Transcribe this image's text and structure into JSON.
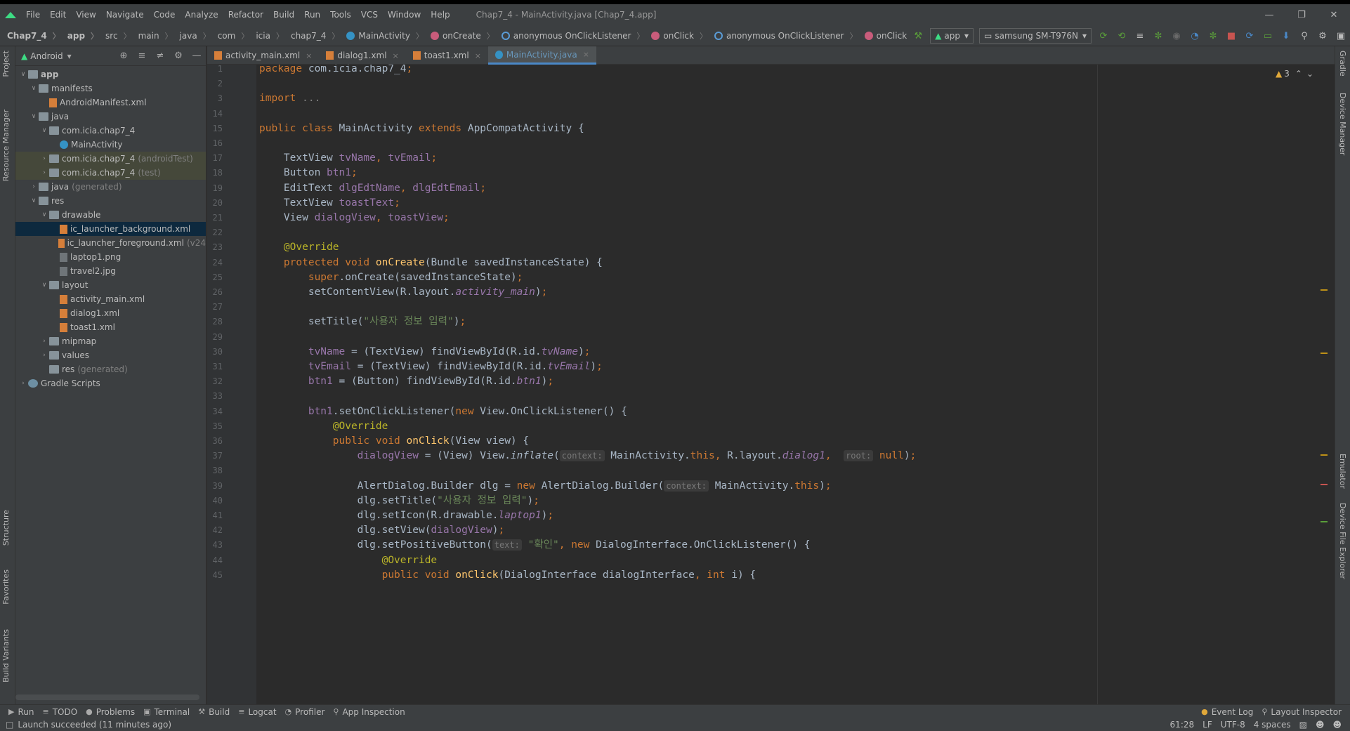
{
  "menubar": {
    "items": [
      "File",
      "Edit",
      "View",
      "Navigate",
      "Code",
      "Analyze",
      "Refactor",
      "Build",
      "Run",
      "Tools",
      "VCS",
      "Window",
      "Help"
    ],
    "title": "Chap7_4 - MainActivity.java [Chap7_4.app]"
  },
  "breadcrumbs": [
    "Chap7_4",
    "app",
    "src",
    "main",
    "java",
    "com",
    "icia",
    "chap7_4",
    "MainActivity",
    "onCreate",
    "anonymous OnClickListener",
    "onClick",
    "anonymous OnClickListener",
    "onClick"
  ],
  "toolbar": {
    "config": "app",
    "device": "samsung SM-T976N"
  },
  "project": {
    "view": "Android",
    "tree": [
      {
        "depth": 0,
        "arrow": "v",
        "icon": "folder",
        "label": "app",
        "bold": true
      },
      {
        "depth": 1,
        "arrow": "v",
        "icon": "folder",
        "label": "manifests"
      },
      {
        "depth": 2,
        "arrow": "",
        "icon": "xml",
        "label": "AndroidManifest.xml"
      },
      {
        "depth": 1,
        "arrow": "v",
        "icon": "folder",
        "label": "java"
      },
      {
        "depth": 2,
        "arrow": "v",
        "icon": "folder",
        "label": "com.icia.chap7_4"
      },
      {
        "depth": 3,
        "arrow": "",
        "icon": "cls",
        "label": "MainActivity"
      },
      {
        "depth": 2,
        "arrow": ">",
        "icon": "folder",
        "label": "com.icia.chap7_4",
        "suffix": "(androidTest)",
        "mod": true
      },
      {
        "depth": 2,
        "arrow": ">",
        "icon": "folder",
        "label": "com.icia.chap7_4",
        "suffix": "(test)",
        "mod": true
      },
      {
        "depth": 1,
        "arrow": ">",
        "icon": "folder",
        "label": "java",
        "suffix": "(generated)"
      },
      {
        "depth": 1,
        "arrow": "v",
        "icon": "folder",
        "label": "res"
      },
      {
        "depth": 2,
        "arrow": "v",
        "icon": "folder",
        "label": "drawable"
      },
      {
        "depth": 3,
        "arrow": "",
        "icon": "xml",
        "label": "ic_launcher_background.xml",
        "sel": true
      },
      {
        "depth": 3,
        "arrow": "",
        "icon": "xml",
        "label": "ic_launcher_foreground.xml",
        "suffix": "(v24"
      },
      {
        "depth": 3,
        "arrow": "",
        "icon": "img",
        "label": "laptop1.png"
      },
      {
        "depth": 3,
        "arrow": "",
        "icon": "img",
        "label": "travel2.jpg"
      },
      {
        "depth": 2,
        "arrow": "v",
        "icon": "folder",
        "label": "layout"
      },
      {
        "depth": 3,
        "arrow": "",
        "icon": "xml",
        "label": "activity_main.xml"
      },
      {
        "depth": 3,
        "arrow": "",
        "icon": "xml",
        "label": "dialog1.xml"
      },
      {
        "depth": 3,
        "arrow": "",
        "icon": "xml",
        "label": "toast1.xml"
      },
      {
        "depth": 2,
        "arrow": ">",
        "icon": "folder",
        "label": "mipmap"
      },
      {
        "depth": 2,
        "arrow": ">",
        "icon": "folder",
        "label": "values"
      },
      {
        "depth": 2,
        "arrow": "",
        "icon": "folder",
        "label": "res",
        "suffix": "(generated)"
      },
      {
        "depth": 0,
        "arrow": ">",
        "icon": "gradle",
        "label": "Gradle Scripts"
      }
    ]
  },
  "tabs": [
    {
      "label": "activity_main.xml",
      "active": false
    },
    {
      "label": "dialog1.xml",
      "active": false
    },
    {
      "label": "toast1.xml",
      "active": false
    },
    {
      "label": "MainActivity.java",
      "active": true
    }
  ],
  "editor": {
    "warnings": "3",
    "lines": [
      {
        "n": "1",
        "parts": [
          [
            "kw",
            "package "
          ],
          [
            "",
            "com.icia.chap7_4"
          ],
          [
            "kw",
            ";"
          ]
        ]
      },
      {
        "n": "2",
        "parts": []
      },
      {
        "n": "3",
        "parts": [
          [
            "kw",
            "import "
          ],
          [
            "gray",
            "..."
          ]
        ]
      },
      {
        "n": "14",
        "parts": []
      },
      {
        "n": "15",
        "parts": [
          [
            "kw",
            "public class "
          ],
          [
            "",
            "MainActivity "
          ],
          [
            "kw",
            "extends "
          ],
          [
            "",
            "AppCompatActivity {"
          ]
        ]
      },
      {
        "n": "16",
        "parts": []
      },
      {
        "n": "17",
        "parts": [
          [
            "",
            "    TextView "
          ],
          [
            "fld",
            "tvName"
          ],
          [
            "kw",
            ", "
          ],
          [
            "fld",
            "tvEmail"
          ],
          [
            "kw",
            ";"
          ]
        ]
      },
      {
        "n": "18",
        "parts": [
          [
            "",
            "    Button "
          ],
          [
            "fld",
            "btn1"
          ],
          [
            "kw",
            ";"
          ]
        ]
      },
      {
        "n": "19",
        "parts": [
          [
            "",
            "    EditText "
          ],
          [
            "fld",
            "dlgEdtName"
          ],
          [
            "kw",
            ", "
          ],
          [
            "fld",
            "dlgEdtEmail"
          ],
          [
            "kw",
            ";"
          ]
        ]
      },
      {
        "n": "20",
        "parts": [
          [
            "",
            "    TextView "
          ],
          [
            "fld",
            "toastText"
          ],
          [
            "kw",
            ";"
          ]
        ]
      },
      {
        "n": "21",
        "parts": [
          [
            "",
            "    View "
          ],
          [
            "fld",
            "dialogView"
          ],
          [
            "kw",
            ", "
          ],
          [
            "fld",
            "toastView"
          ],
          [
            "kw",
            ";"
          ]
        ]
      },
      {
        "n": "22",
        "parts": []
      },
      {
        "n": "23",
        "parts": [
          [
            "ann",
            "    @Override"
          ]
        ]
      },
      {
        "n": "24",
        "parts": [
          [
            "kw",
            "    protected void "
          ],
          [
            "mth",
            "onCreate"
          ],
          [
            "",
            "(Bundle savedInstanceState) {"
          ]
        ]
      },
      {
        "n": "25",
        "parts": [
          [
            "kw",
            "        super"
          ],
          [
            "",
            ".onCreate(savedInstanceState)"
          ],
          [
            "kw",
            ";"
          ]
        ]
      },
      {
        "n": "26",
        "parts": [
          [
            "",
            "        setContentView(R.layout."
          ],
          [
            "it-fld",
            "activity_main"
          ],
          [
            "",
            ")"
          ],
          [
            "kw",
            ";"
          ]
        ]
      },
      {
        "n": "27",
        "parts": []
      },
      {
        "n": "28",
        "parts": [
          [
            "",
            "        setTitle("
          ],
          [
            "str",
            "\"사용자 정보 입력\""
          ],
          [
            "",
            ")"
          ],
          [
            "kw",
            ";"
          ]
        ]
      },
      {
        "n": "29",
        "parts": []
      },
      {
        "n": "30",
        "parts": [
          [
            "fld",
            "        tvName "
          ],
          [
            "",
            "= (TextView) findViewById(R.id."
          ],
          [
            "it-fld",
            "tvName"
          ],
          [
            "",
            ")"
          ],
          [
            "kw",
            ";"
          ]
        ]
      },
      {
        "n": "31",
        "parts": [
          [
            "fld",
            "        tvEmail "
          ],
          [
            "",
            "= (TextView) findViewById(R.id."
          ],
          [
            "it-fld",
            "tvEmail"
          ],
          [
            "",
            ")"
          ],
          [
            "kw",
            ";"
          ]
        ]
      },
      {
        "n": "32",
        "parts": [
          [
            "fld",
            "        btn1 "
          ],
          [
            "",
            "= (Button) findViewById(R.id."
          ],
          [
            "it-fld",
            "btn1"
          ],
          [
            "",
            ")"
          ],
          [
            "kw",
            ";"
          ]
        ]
      },
      {
        "n": "33",
        "parts": []
      },
      {
        "n": "34",
        "parts": [
          [
            "fld",
            "        btn1"
          ],
          [
            "",
            ".setOnClickListener("
          ],
          [
            "kw",
            "new "
          ],
          [
            "",
            "View.OnClickListener() {"
          ]
        ]
      },
      {
        "n": "35",
        "parts": [
          [
            "ann",
            "            @Override"
          ]
        ]
      },
      {
        "n": "36",
        "parts": [
          [
            "kw",
            "            public void "
          ],
          [
            "mth",
            "onClick"
          ],
          [
            "",
            "(View view) {"
          ]
        ]
      },
      {
        "n": "37",
        "parts": [
          [
            "fld",
            "                dialogView "
          ],
          [
            "",
            "= (View) View."
          ],
          [
            "it-m",
            "inflate"
          ],
          [
            "",
            "("
          ],
          [
            "hint",
            "context:"
          ],
          [
            "",
            " MainActivity."
          ],
          [
            "kw",
            "this, "
          ],
          [
            "",
            "R.layout."
          ],
          [
            "it-fld",
            "dialog1"
          ],
          [
            "kw",
            ",  "
          ],
          [
            "hint",
            "root:"
          ],
          [
            "kw",
            " null"
          ],
          [
            "",
            ")"
          ],
          [
            "kw",
            ";"
          ]
        ]
      },
      {
        "n": "38",
        "parts": []
      },
      {
        "n": "39",
        "parts": [
          [
            "",
            "                AlertDialog.Builder dlg = "
          ],
          [
            "kw",
            "new "
          ],
          [
            "",
            "AlertDialog.Builder("
          ],
          [
            "hint",
            "context:"
          ],
          [
            "",
            " MainActivity."
          ],
          [
            "kw",
            "this"
          ],
          [
            "",
            ")"
          ],
          [
            "kw",
            ";"
          ]
        ]
      },
      {
        "n": "40",
        "parts": [
          [
            "",
            "                dlg.setTitle("
          ],
          [
            "str",
            "\"사용자 정보 입력\""
          ],
          [
            "",
            ")"
          ],
          [
            "kw",
            ";"
          ]
        ]
      },
      {
        "n": "41",
        "parts": [
          [
            "",
            "                dlg.setIcon(R.drawable."
          ],
          [
            "it-fld",
            "laptop1"
          ],
          [
            "",
            ")"
          ],
          [
            "kw",
            ";"
          ]
        ]
      },
      {
        "n": "42",
        "parts": [
          [
            "",
            "                dlg.setView("
          ],
          [
            "fld",
            "dialogView"
          ],
          [
            "",
            ")"
          ],
          [
            "kw",
            ";"
          ]
        ]
      },
      {
        "n": "43",
        "parts": [
          [
            "",
            "                dlg.setPositiveButton("
          ],
          [
            "hint",
            "text:"
          ],
          [
            "str",
            " \"확인\""
          ],
          [
            "kw",
            ", new "
          ],
          [
            "",
            "DialogInterface.OnClickListener() {"
          ]
        ]
      },
      {
        "n": "44",
        "parts": [
          [
            "ann",
            "                    @Override"
          ]
        ]
      },
      {
        "n": "45",
        "parts": [
          [
            "kw",
            "                    public void "
          ],
          [
            "mth",
            "onClick"
          ],
          [
            "",
            "(DialogInterface dialogInterface"
          ],
          [
            "kw",
            ", int "
          ],
          [
            "",
            "i) {"
          ]
        ]
      }
    ]
  },
  "left_stripe": [
    "Project",
    "Resource Manager",
    "Structure",
    "Favorites",
    "Build Variants"
  ],
  "right_stripe": [
    "Gradle",
    "Device Manager",
    "Emulator",
    "Device File Explorer"
  ],
  "bottom_tools": [
    "Run",
    "TODO",
    "Problems",
    "Terminal",
    "Build",
    "Logcat",
    "Profiler",
    "App Inspection"
  ],
  "bottom_right": [
    "Event Log",
    "Layout Inspector"
  ],
  "status": {
    "message": "Launch succeeded (11 minutes ago)",
    "position": "61:28",
    "line_sep": "LF",
    "encoding": "UTF-8",
    "indent": "4 spaces"
  }
}
